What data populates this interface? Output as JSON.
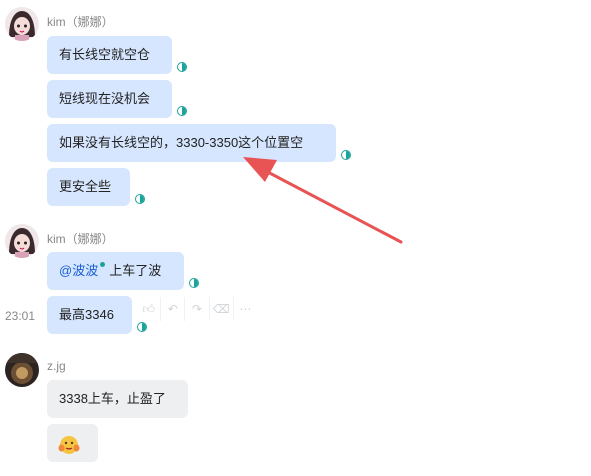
{
  "groups": [
    {
      "sender": "kim（娜娜）",
      "messages": [
        "有长线空就空仓",
        "短线现在没机会",
        "如果没有长线空的，3330-3350这个位置空",
        "更安全些"
      ]
    },
    {
      "sender": "kim（娜娜）",
      "mention": "@波波",
      "message1_suffix": "上车了波",
      "time": "23:01",
      "message2": "最高3346"
    },
    {
      "sender": "z.jg",
      "message1": "3338上车，止盈了"
    }
  ],
  "hover_tools": [
    "like-icon",
    "reply-icon",
    "forward-icon",
    "delete-icon",
    "more-icon"
  ],
  "colors": {
    "bubble_self": "#d6e6ff",
    "bubble_other": "#eeeff1",
    "read_status": "#1aa39a",
    "annotation_arrow": "#e85454"
  },
  "emoji": "face-hands-emoji"
}
